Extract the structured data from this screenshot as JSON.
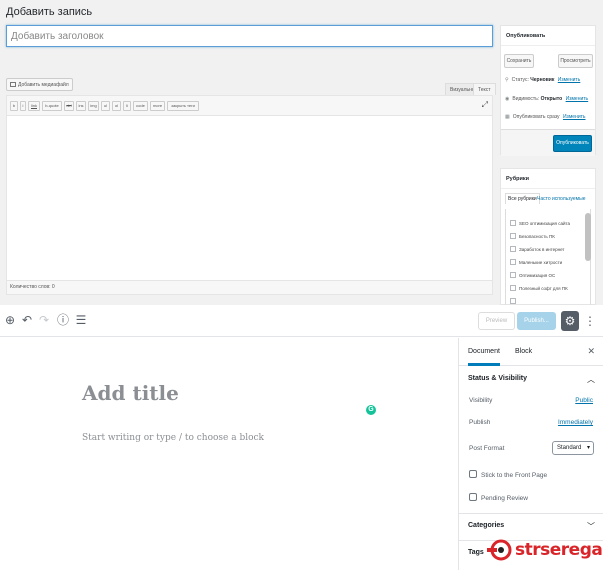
{
  "classic": {
    "page_title": "Добавить запись",
    "title_placeholder": "Добавить заголовок",
    "add_media_label": "Добавить медиафайл",
    "tab_visual": "Визуально",
    "tab_text": "Текст",
    "quicktags": [
      "b",
      "i",
      "link",
      "b-quote",
      "del",
      "ins",
      "img",
      "ul",
      "ol",
      "li",
      "code",
      "more",
      "закрыть теги"
    ],
    "word_count": "Количество слов: 0",
    "publish_box": {
      "heading": "Опубликовать",
      "save_label": "Сохранить",
      "preview_label": "Просмотреть",
      "status_label": "Статус:",
      "status_value": "Черновик",
      "visibility_label": "Видимость:",
      "visibility_value": "Открыто",
      "schedule_label": "Опубликовать сразу",
      "edit_link": "Изменить",
      "publish_label": "Опубликовать"
    },
    "categories_box": {
      "heading": "Рубрики",
      "tab_all": "Все рубрики",
      "tab_popular": "Часто используемые",
      "items": [
        "SEO оптимизация сайта",
        "Безопасность ПК",
        "Заработок в интернет",
        "Маленькие хитрости",
        "Оптимизация ОС",
        "Полезный софт для ПК"
      ]
    }
  },
  "gutenberg": {
    "toolbar": {
      "preview_label": "Preview",
      "publish_label": "Publish..."
    },
    "canvas": {
      "title_placeholder": "Add title",
      "body_placeholder": "Start writing or type / to choose a block"
    },
    "sidebar": {
      "tab_document": "Document",
      "tab_block": "Block",
      "status_heading": "Status & Visibility",
      "visibility_label": "Visibility",
      "visibility_value": "Public",
      "publish_label": "Publish",
      "publish_value": "Immediately",
      "post_format_label": "Post Format",
      "post_format_value": "Standard",
      "sticky_label": "Stick to the Front Page",
      "pending_label": "Pending Review",
      "categories_heading": "Categories",
      "tags_heading": "Tags"
    }
  },
  "watermark": "strserega",
  "colors": {
    "accent": "#0085ba",
    "link": "#0073aa",
    "publish_disabled": "#a6d3e9",
    "watermark": "#d9252a"
  }
}
